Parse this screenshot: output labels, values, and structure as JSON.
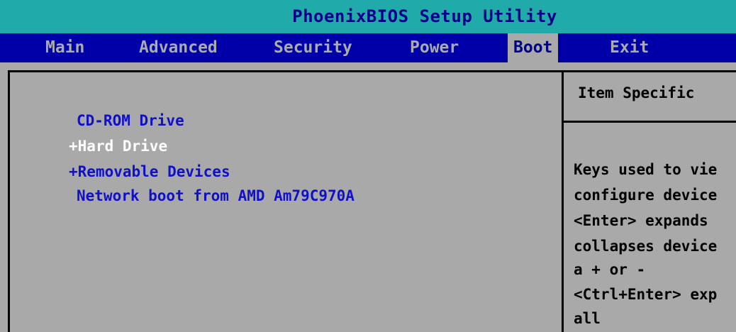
{
  "title": "PhoenixBIOS Setup Utility",
  "menu": [
    {
      "label": "Main",
      "active": false
    },
    {
      "label": "Advanced",
      "active": false
    },
    {
      "label": "Security",
      "active": false
    },
    {
      "label": "Power",
      "active": false
    },
    {
      "label": "Boot",
      "active": true
    },
    {
      "label": "Exit",
      "active": false
    }
  ],
  "boot_order": [
    {
      "label": "CD-ROM Drive",
      "prefix": " "
    },
    {
      "label": "Hard Drive",
      "prefix": "+",
      "selected": true
    },
    {
      "label": "Removable Devices",
      "prefix": "+"
    },
    {
      "label": "Network boot from AMD Am79C970A",
      "prefix": " "
    }
  ],
  "help": {
    "title": "Item Specific",
    "lines": [
      "Keys used to vie",
      "configure device",
      "<Enter> expands",
      "collapses device",
      "a + or -",
      "<Ctrl+Enter> exp",
      "all"
    ]
  },
  "colors": {
    "title_bg": "#20aaaa",
    "menu_bg": "#0000a8",
    "panel_bg": "#a9a9aa",
    "item_text": "#1010c8",
    "selected_text": "#ffffff"
  }
}
